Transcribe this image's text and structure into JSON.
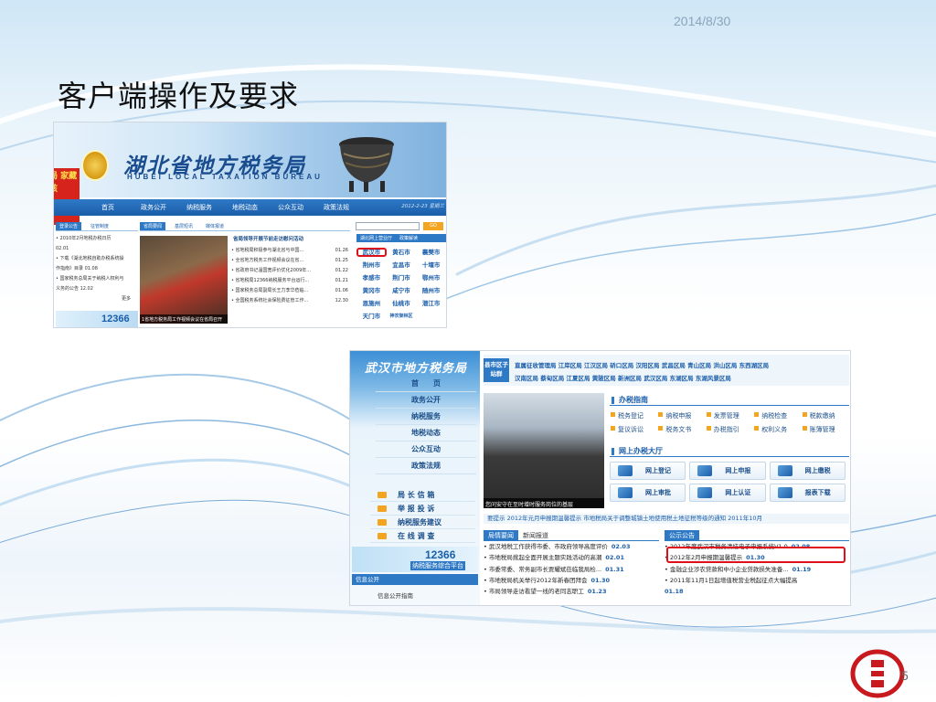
{
  "slide": {
    "date": "2014/8/30",
    "title": "客户端操作及要求",
    "page_number": "5"
  },
  "hubei_site": {
    "logo_cn": "湖北省地方税务局",
    "logo_en": "HUBEI LOCAL TAXATION BUREAU",
    "stamp_text": "务局 家藏男孩",
    "nav": [
      "首页",
      "政务公开",
      "纳税服务",
      "地税动态",
      "公众互动",
      "政策法规"
    ],
    "nav_date": "2012-2-23 星期三",
    "left_tabs": [
      "登录公告",
      "征管制度"
    ],
    "left_news": [
      "• 2010年2月地税办税日历",
      "02.01",
      "• 下载《湖北地税自助办税系统操",
      "作指南》目录  01.08",
      "• 国家税务总局关于纳税人权利与",
      "义务的公告  12.02"
    ],
    "left_more": "更多",
    "center_tabs": [
      "省局要闻",
      "基层短讯",
      "媒体报道"
    ],
    "center_headline": "省局领导开展节前走访慰问活动",
    "center_news": [
      {
        "t": "• 省地税局积极参与湖北省与中国...",
        "d": "01.26"
      },
      {
        "t": "• 全省地方税务工作视频会议在省...",
        "d": "01.25"
      },
      {
        "t": "• 省政府书记温国宽评价优化2009年...",
        "d": "01.22"
      },
      {
        "t": "• 省地税局12366纳税服务平台运行...",
        "d": "01.21"
      },
      {
        "t": "• 国家税务总局副局长王力李华莅临...",
        "d": "01.06"
      },
      {
        "t": "• 全国税务系统社会保险费征管工作...",
        "d": "12.30"
      }
    ],
    "photo_caption": "1省地方税务局工作视频会议在省局召开",
    "search_button": "GO",
    "city_tabs": [
      "湖北网上营业厅",
      "政策解读"
    ],
    "cities": [
      "武汉市",
      "黄石市",
      "襄樊市",
      "荆州市",
      "宜昌市",
      "十堰市",
      "孝感市",
      "荆门市",
      "鄂州市",
      "黄冈市",
      "咸宁市",
      "随州市",
      "恩施州",
      "仙桃市",
      "潜江市",
      "天门市",
      "神农架林区",
      ""
    ],
    "ad_number": "12366"
  },
  "wuhan_site": {
    "logo": "武汉市地方税务局",
    "menu": [
      "首　　页",
      "政务公开",
      "纳税服务",
      "地税动态",
      "公众互动",
      "政策法规"
    ],
    "links": [
      "局 长 信 箱",
      "举 报 投 诉",
      "纳税服务建议",
      "在 线 调 查"
    ],
    "ad_number": "12366",
    "ad_text": "纳税服务综合平台",
    "info_public": "信息公开",
    "info_guide": "信息公开指南",
    "district_tag": "县市区子站群",
    "districts_row1": "直属征收管理局  江岸区局  江汉区局  硚口区局  汉阳区局  武昌区局  青山区局  洪山区局  东西湖区局",
    "districts_row2": "汉南区局  蔡甸区局  江夏区局  黄陂区局  新洲区局  武汉区局  东湖区局  东湖风景区局",
    "photo_caption": "您问安守在至时增时服务岗位的基层",
    "guide_title": "办税指南",
    "guide_items": [
      "税务登记",
      "纳税申报",
      "发票管理",
      "纳税检查",
      "税款缴纳",
      "复议诉讼",
      "税务文书",
      "办税指引",
      "权利义务",
      "账簿管理"
    ],
    "hall_title": "网上办税大厅",
    "hall_items": [
      "网上登记",
      "网上申报",
      "网上缴税",
      "网上审批",
      "网上认证",
      "报表下载"
    ],
    "ticker": "要提示    2012年元月申报期温馨提示    市地税局关于调整城镇土地使用税土地征税等级的通知    2011年10月",
    "news_tabs": [
      "局情要闻",
      "新闻报道"
    ],
    "news": [
      {
        "t": "• 武汉地税工作获得市委、市政府领导高度评价",
        "d": "02.03"
      },
      {
        "t": "• 市地税局掀起全面开展主题实践活动的高潮",
        "d": "02.01"
      },
      {
        "t": "• 市委常委、常务副市长贾耀斌莅临我局检...",
        "d": "01.31"
      },
      {
        "t": "• 市地税局机关举行2012年新春团拜会",
        "d": "01.30"
      },
      {
        "t": "• 市局领导走访看望一线的老同志职工",
        "d": "01.23"
      }
    ],
    "notice_tab": "公示公告",
    "notices": [
      {
        "t": "• 2012年度武汉市税务清结电子申报系统V1.0",
        "d": "02.08"
      },
      {
        "t": "• 2012年2月申报期温馨提示",
        "d": "01.30"
      },
      {
        "t": "• 金融企业涉农贷款和中小企业贷款损失准备...",
        "d": "01.19"
      },
      {
        "t": "• 2011年11月1日起增值税营业税起征点大幅提高",
        "d": ""
      },
      {
        "t": "01.18",
        "d": ""
      }
    ]
  }
}
